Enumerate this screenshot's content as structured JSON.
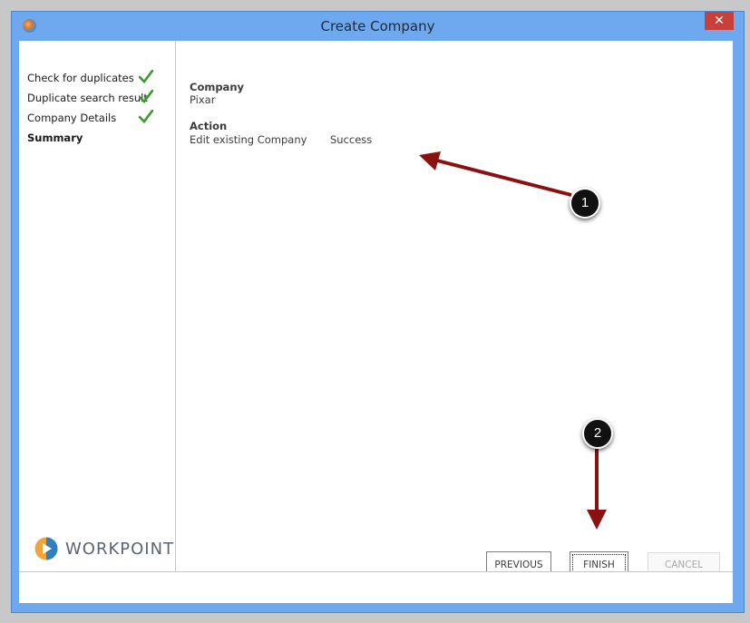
{
  "window": {
    "title": "Create Company",
    "close_symbol": "✕"
  },
  "sidebar": {
    "steps": [
      {
        "label": "Check for duplicates",
        "done": true
      },
      {
        "label": "Duplicate search result",
        "done": true
      },
      {
        "label": "Company Details",
        "done": true
      },
      {
        "label": "Summary",
        "active": true
      }
    ]
  },
  "logo": {
    "text": "WORKPOINT"
  },
  "summary": {
    "company_heading": "Company",
    "company_value": "Pixar",
    "action_heading": "Action",
    "action_value": "Edit existing Company",
    "action_status": "Success"
  },
  "buttons": {
    "previous": "PREVIOUS",
    "finish": "FINISH",
    "cancel": "CANCEL"
  },
  "annotations": {
    "badge1": "1",
    "badge2": "2"
  },
  "colors": {
    "titlebar": "#6ea8ef",
    "close": "#c9403a",
    "check": "#3a9a2c",
    "arrow": "#8b1010"
  }
}
